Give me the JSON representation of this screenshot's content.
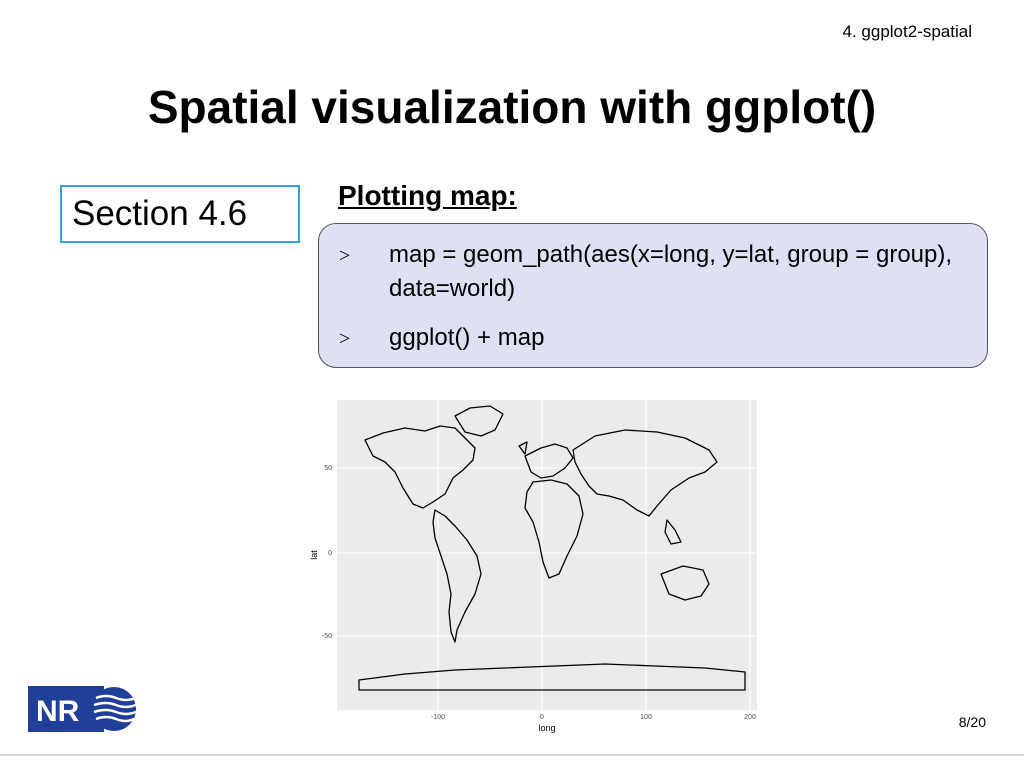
{
  "header": {
    "chapter_label": "4. ggplot2-spatial"
  },
  "slide": {
    "title": "Spatial visualization with ggplot()",
    "section_label": "Section 4.6",
    "subheading": "Plotting map:",
    "code_lines": [
      {
        "bullet": ">",
        "text": "map = geom_path(aes(x=long, y=lat, group = group), data=world)"
      },
      {
        "bullet": ">",
        "text": "ggplot() + map"
      }
    ]
  },
  "plot": {
    "xlabel": "long",
    "ylabel": "lat",
    "x_ticks": [
      "-100",
      "0",
      "100",
      "200"
    ],
    "y_ticks": [
      "50",
      "0",
      "-50"
    ],
    "panel_color": "#ebebeb",
    "grid_color": "#ffffff"
  },
  "logo": {
    "text": "NR",
    "color": "#1f3f99"
  },
  "footer": {
    "page_number": "8/20"
  }
}
